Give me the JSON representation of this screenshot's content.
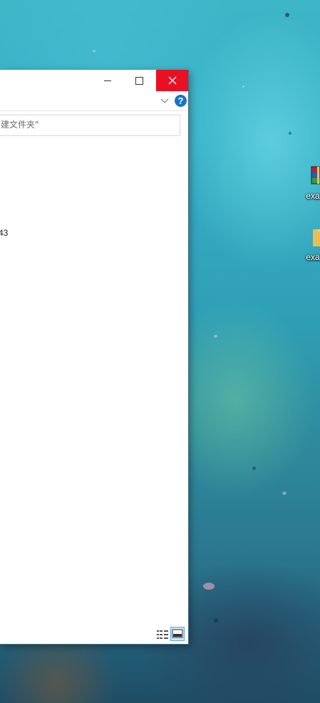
{
  "desktop": {
    "icons": [
      {
        "label": "exam",
        "icon": "winrar-archive-icon"
      },
      {
        "label": "exam",
        "icon": "folder-icon"
      }
    ]
  },
  "window": {
    "title_buttons": {
      "minimize": "minimize-icon",
      "maximize": "maximize-icon",
      "close": "close-icon"
    },
    "ribbon": {
      "expand_icon": "chevron-down-icon",
      "help_label": "?"
    },
    "search": {
      "placeholder": "建文件夹\""
    },
    "content": {
      "partial_text": "43"
    },
    "statusbar": {
      "details_view_icon": "details-view-icon",
      "tiles_view_icon": "large-icons-view-icon",
      "active_view": "large-icons"
    }
  },
  "colors": {
    "close_button": "#e81123",
    "help_button": "#1a73c9",
    "active_view_bg": "#cfe6f7"
  }
}
